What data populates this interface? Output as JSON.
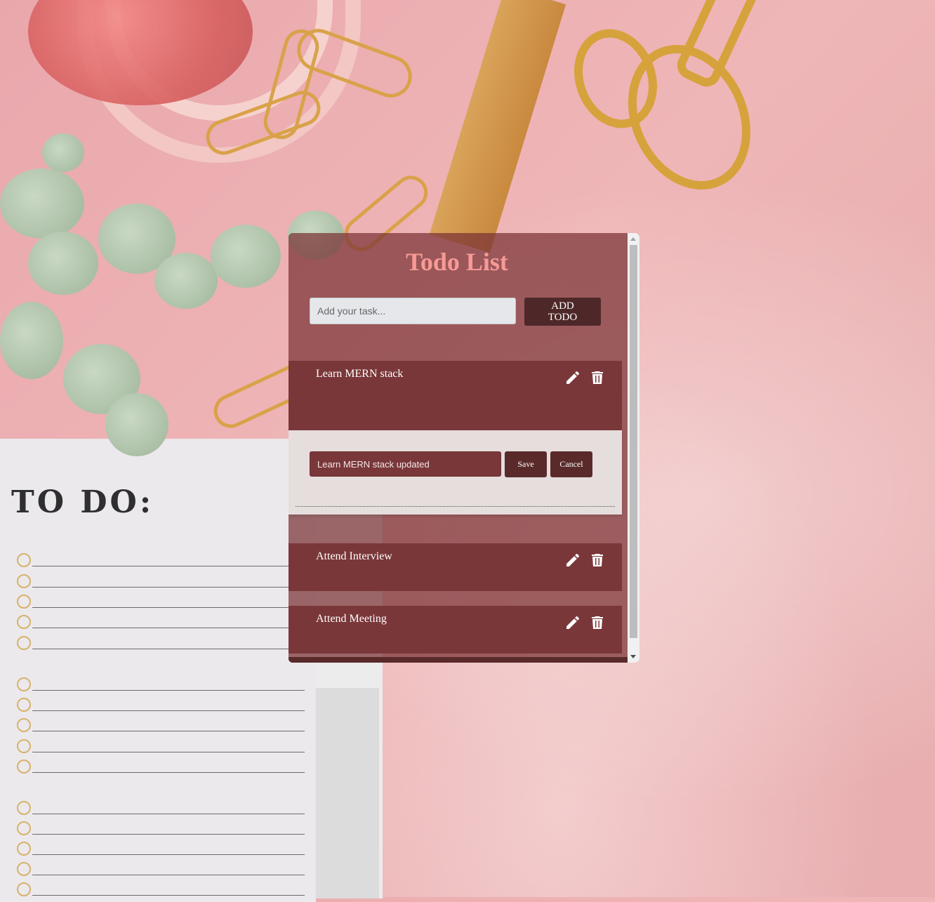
{
  "app": {
    "title": "Todo List",
    "input": {
      "placeholder": "Add your task...",
      "value": ""
    },
    "add_button_label": "ADD TODO",
    "todos": [
      {
        "text": "Learn MERN stack",
        "editing": true
      },
      {
        "text": "Attend Interview",
        "editing": false
      },
      {
        "text": "Attend Meeting",
        "editing": false
      }
    ],
    "edit": {
      "value": "Learn MERN stack updated",
      "save_label": "Save",
      "cancel_label": "Cancel"
    },
    "icons": {
      "edit": "pencil-icon",
      "delete": "trash-icon"
    }
  },
  "background": {
    "notebook_heading": "TO DO:"
  },
  "colors": {
    "panel": "#7a3739",
    "title": "#f79a96",
    "button": "#4e2829",
    "edit_panel": "#e6dddd"
  }
}
